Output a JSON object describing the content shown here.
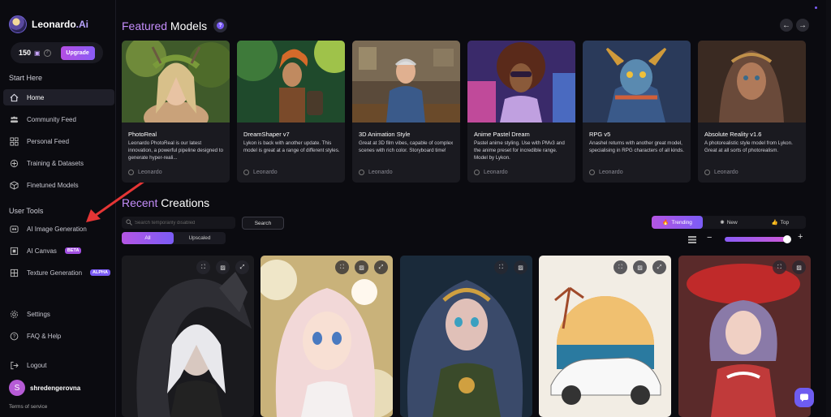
{
  "app": {
    "brand_name": "Leonardo",
    "brand_suffix": ".Ai"
  },
  "account": {
    "tokens": "150",
    "upgrade_label": "Upgrade"
  },
  "sidebar": {
    "start_here_title": "Start Here",
    "start_items": [
      {
        "label": "Home",
        "icon": "home-icon",
        "active": true
      },
      {
        "label": "Community Feed",
        "icon": "community-icon"
      },
      {
        "label": "Personal Feed",
        "icon": "grid-icon"
      },
      {
        "label": "Training & Datasets",
        "icon": "training-icon"
      },
      {
        "label": "Finetuned Models",
        "icon": "cube-icon"
      }
    ],
    "user_tools_title": "User Tools",
    "tool_items": [
      {
        "label": "AI Image Generation",
        "icon": "image-gen-icon"
      },
      {
        "label": "AI Canvas",
        "icon": "canvas-icon",
        "badge": "BETA"
      },
      {
        "label": "Texture Generation",
        "icon": "texture-icon",
        "badge": "ALPHA"
      }
    ],
    "bottom_items": [
      {
        "label": "Settings",
        "icon": "gear-icon"
      },
      {
        "label": "FAQ & Help",
        "icon": "help-icon"
      },
      {
        "label": "Logout",
        "icon": "logout-icon"
      }
    ],
    "user": {
      "avatar_letter": "S",
      "username": "shredengerovna"
    },
    "terms_label": "Terms of service"
  },
  "featured": {
    "title_accent": "Featured",
    "title_rest": " Models",
    "models": [
      {
        "name": "PhotoReal",
        "desc": "Leonardo PhotoReal is our latest innovation, a powerful pipeline designed to generate hyper-reali...",
        "author": "Leonardo"
      },
      {
        "name": "DreamShaper v7",
        "desc": "Lykon is back with another update. This model is great at a range of different styles.",
        "author": "Leonardo"
      },
      {
        "name": "3D Animation Style",
        "desc": "Great at 3D film vibes, capable of complex scenes with rich color. Storyboard time!",
        "author": "Leonardo"
      },
      {
        "name": "Anime Pastel Dream",
        "desc": "Pastel anime styling. Use with PMv3 and the anime preset for incredible range. Model by Lykon.",
        "author": "Leonardo"
      },
      {
        "name": "RPG v5",
        "desc": "Anashel returns with another great model, specialising in RPG characters of all kinds.",
        "author": "Leonardo"
      },
      {
        "name": "Absolute Reality v1.6",
        "desc": "A photorealistic style model from Lykon. Great at all sorts of photorealism.",
        "author": "Leonardo"
      }
    ]
  },
  "recent": {
    "title_accent": "Recent",
    "title_rest": " Creations",
    "search_placeholder": "Search temporarily disabled",
    "search_button": "Search",
    "filter_tabs": [
      "All",
      "Upscaled"
    ],
    "sort_tabs": [
      "Trending",
      "New",
      "Top"
    ],
    "zoom_level": 0.9
  },
  "colors": {
    "accent": "#b455e3",
    "accent2": "#7b5cf6",
    "title_accent": "#c48dfa"
  }
}
